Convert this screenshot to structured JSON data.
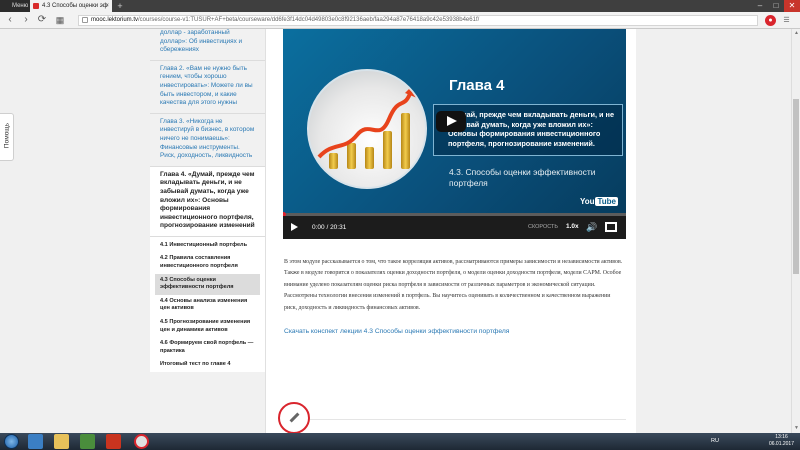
{
  "browser": {
    "tabs": [
      {
        "label": "Меню",
        "active": false
      },
      {
        "label": "4.3 Способы оценки эф",
        "active": true
      }
    ],
    "url_host": "mooc.lektorium.tv",
    "url_path": "/courses/course-v1:TUSUR+AF+beta/courseware/dd6fe3f14dc04d49803e0c8f92136aeb/faa294a87e76418a9c42e53938b4e61f/",
    "window_buttons": [
      "–",
      "□",
      "✕"
    ],
    "nav": [
      "‹",
      "›",
      "⟳"
    ]
  },
  "help_tab": "Помощь",
  "sidebar": {
    "chapters": [
      {
        "label": "доллар - заработанный доллар»: Об инвестициях и сбережениях"
      },
      {
        "label": "Глава 2. «Вам не нужно быть гением, чтобы хорошо инвестировать»: Можете ли вы быть инвестором, и какие качества для этого нужны"
      },
      {
        "label": "Глава 3. «Никогда не инвестируй в бизнес, в котором ничего не понимаешь»: Финансовые инструменты. Риск, доходность, ликвидность"
      },
      {
        "label": "Глава 4. «Думай, прежде чем вкладывать деньги, и не забывай думать, когда уже вложил их»: Основы формирования инвестиционного портфеля, прогнозирование изменений"
      }
    ],
    "subsections": [
      {
        "label": "4.1 Инвестиционный портфель",
        "selected": false
      },
      {
        "label": "4.2 Правила составления инвестиционного портфеля",
        "selected": false
      },
      {
        "label": "4.3 Способы оценки эффективности портфеля",
        "selected": true
      },
      {
        "label": "4.4 Основы анализа изменения цен активов",
        "selected": false
      },
      {
        "label": "4.5 Прогнозирование изменения цен и динамики активов",
        "selected": false
      },
      {
        "label": "4.6 Формируем свой портфель — практика",
        "selected": false
      },
      {
        "label": "Итоговый тест по главе 4",
        "selected": false
      }
    ]
  },
  "video": {
    "chapter_title": "Глава 4",
    "quote": "«Думай, прежде чем вкладывать деньги, и не забывай думать, когда уже вложил их»: Основы формирования инвестиционного портфеля, прогнозирование изменений.",
    "lecture": "4.3. Способы оценки эффективности портфеля",
    "time": "0:00 / 20:31",
    "speed_label": "СКОРОСТЬ",
    "speed_value": "1.0x",
    "youtube": "You",
    "youtube_tube": "Tube",
    "progress": 0.0
  },
  "description": "В этом модуле рассказывается о том, что такое корреляция активов, рассматриваются примеры зависимости и независимости активов. Также в модуле говорится о показателях оценки доходности портфеля, о модели оценки доходности портфеля, модели CAPM. Особое внимание уделено показателям оценки риска портфеля в зависимости от различных параметров и экономической ситуации. Рассмотрены технологии внесения изменений в портфель. Вы научитесь оценивать в количественном и качественном выражении риск, доходность и ликвидность финансовых активов.",
  "download_link": "Скачать конспект лекции 4.3 Способы оценки эффективности портфеля",
  "taskbar": {
    "lang": "RU",
    "time": "13:16",
    "date": "06.01.2017"
  },
  "colors": {
    "accent": "#2a79b4",
    "video_bg": "#0a5f8c",
    "edit_ring": "#d9252d"
  }
}
